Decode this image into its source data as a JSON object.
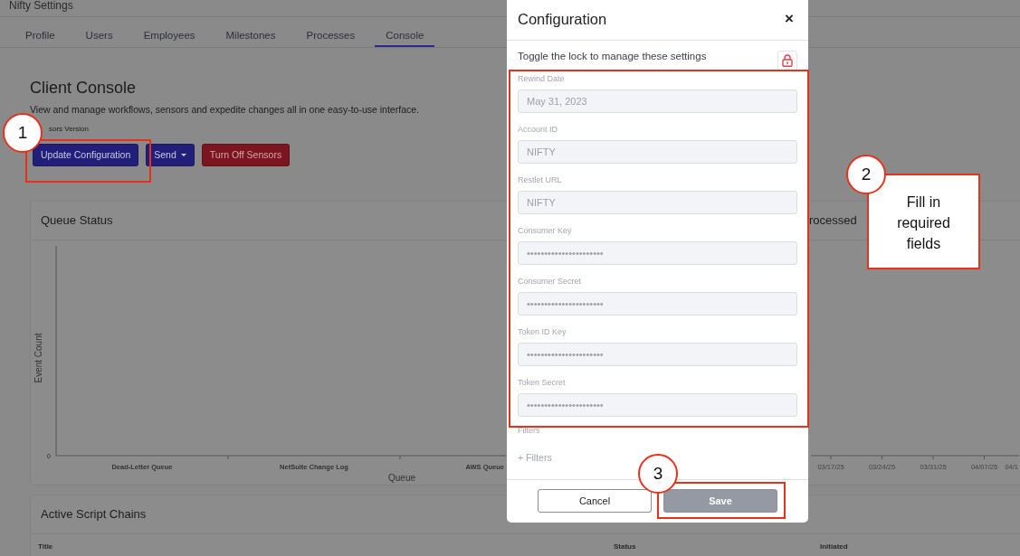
{
  "app": {
    "title": "Nifty Settings"
  },
  "tabs": [
    {
      "label": "Profile",
      "selected": false
    },
    {
      "label": "Users",
      "selected": false
    },
    {
      "label": "Employees",
      "selected": false
    },
    {
      "label": "Milestones",
      "selected": false
    },
    {
      "label": "Processes",
      "selected": false
    },
    {
      "label": "Console",
      "selected": true
    }
  ],
  "page": {
    "heading": "Client Console",
    "description": "View and manage workflows, sensors and expedite changes all in one easy-to-use interface.",
    "version_label": "sors Version",
    "buttons": [
      {
        "label": "Update Configuration",
        "kind": "primary"
      },
      {
        "label": "Send",
        "kind": "dropdown"
      },
      {
        "label": "Turn Off Sensors",
        "kind": "danger"
      }
    ]
  },
  "cards": [
    {
      "title": "Queue Status",
      "kind": "queue",
      "y_axis_title": "Event Count",
      "y_tick": "0",
      "categories": [
        "Dead-Letter Queue",
        "NetSuite Change Log",
        "AWS Queue"
      ],
      "x_axis_title": "Queue"
    },
    {
      "title": "rocessed",
      "kind": "timeline",
      "date_labels": [
        "03/17/25",
        "03/24/25",
        "03/31/25",
        "04/07/25",
        "04/1"
      ]
    }
  ],
  "script_chains": {
    "title": "Active Script Chains",
    "columns": [
      "Title",
      "Status",
      "Initiated"
    ]
  },
  "modal": {
    "title": "Configuration",
    "close": "×",
    "note": "Toggle the lock to manage these settings",
    "fields": [
      {
        "label": "Rewind Date",
        "value": "May 31, 2023",
        "disabled": true
      },
      {
        "label": "Account ID",
        "value": "NIFTY",
        "disabled": true
      },
      {
        "label": "Restlet URL",
        "value": "NIFTY",
        "disabled": true
      },
      {
        "label": "Consumer Key",
        "value": "••••••••••••••••••••••",
        "disabled": true
      },
      {
        "label": "Consumer Secret",
        "value": "••••••••••••••••••••••",
        "disabled": true
      },
      {
        "label": "Token ID Key",
        "value": "••••••••••••••••••••••",
        "disabled": true
      },
      {
        "label": "Token Secret",
        "value": "••••••••••••••••••••••",
        "disabled": true
      }
    ],
    "filters_label": "Filters",
    "add_filter": "+ Filters",
    "buttons": [
      {
        "label": "Cancel",
        "kind": "secondary"
      },
      {
        "label": "Save",
        "kind": "primary",
        "disabled": true
      }
    ]
  },
  "callouts": [
    {
      "number": "1"
    },
    {
      "number": "2",
      "text": "Fill in required fields"
    },
    {
      "number": "3"
    }
  ]
}
